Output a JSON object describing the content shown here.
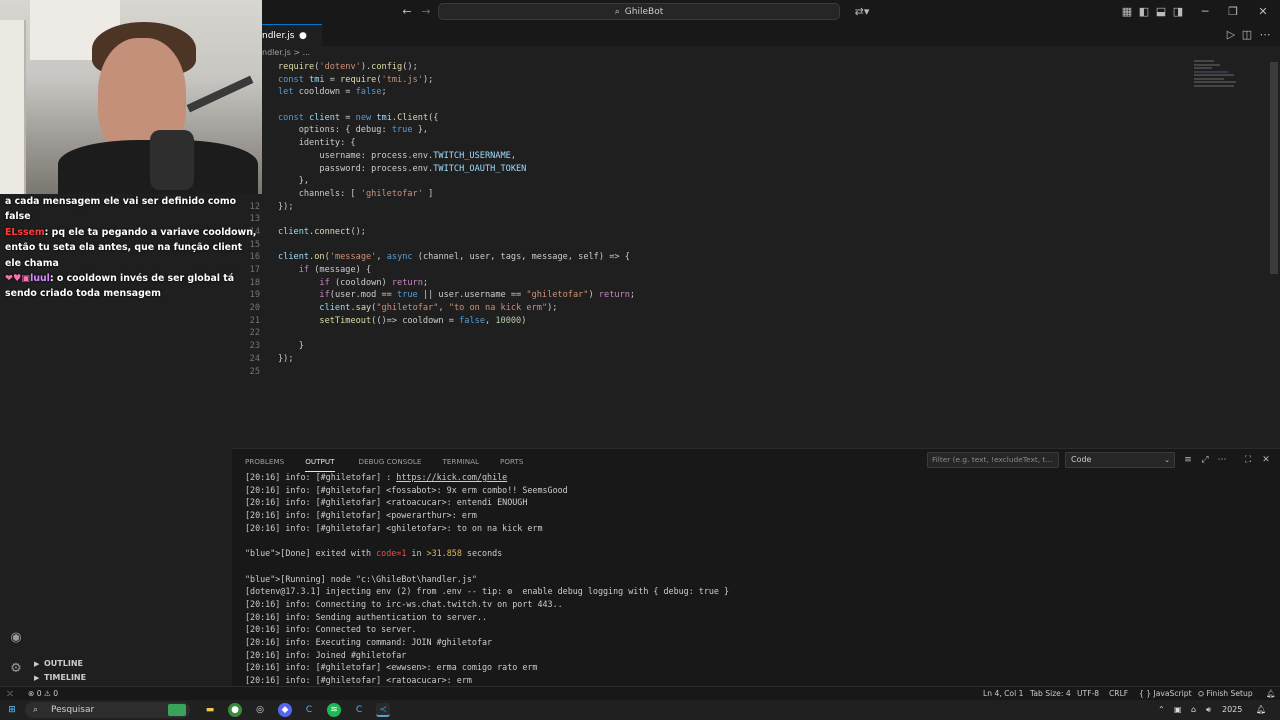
{
  "titlebar": {
    "search_text": "GhileBot"
  },
  "webcam_chat": {
    "messages": [
      {
        "user": "",
        "text": "a cada mensagem ele vai ser definido como false"
      },
      {
        "user": "ELssem",
        "text": ": pq ele ta pegando a variave cooldown, então tu seta ela antes, que na função client ele chama"
      },
      {
        "user": "luul",
        "text": ": o cooldown invés de ser global tá sendo criado toda mensagem"
      }
    ]
  },
  "sidebar": {
    "outline_label": "OUTLINE",
    "timeline_label": "TIMELINE"
  },
  "editor": {
    "tab_label": "ndler.js",
    "breadcrumb": "ndler.js > ...",
    "lines": [
      {
        "n": "",
        "t": "require('dotenv').config();"
      },
      {
        "n": "",
        "t": "const tmi = require('tmi.js');"
      },
      {
        "n": "",
        "t": "let cooldown = false;"
      },
      {
        "n": "",
        "t": ""
      },
      {
        "n": "",
        "t": "const client = new tmi.Client({"
      },
      {
        "n": "",
        "t": "    options: { debug: true },"
      },
      {
        "n": "",
        "t": "    identity: {"
      },
      {
        "n": "",
        "t": "        username: process.env.TWITCH_USERNAME,"
      },
      {
        "n": "",
        "t": "        password: process.env.TWITCH_OAUTH_TOKEN"
      },
      {
        "n": "",
        "t": "    },"
      },
      {
        "n": "",
        "t": "    channels: [ 'ghiletofar' ]"
      },
      {
        "n": "12",
        "t": "});"
      },
      {
        "n": "13",
        "t": ""
      },
      {
        "n": "14",
        "t": "client.connect();"
      },
      {
        "n": "15",
        "t": ""
      },
      {
        "n": "16",
        "t": "client.on('message', async (channel, user, tags, message, self) => {"
      },
      {
        "n": "17",
        "t": "    if (message) {"
      },
      {
        "n": "18",
        "t": "        if (cooldown) return;"
      },
      {
        "n": "19",
        "t": "        if(user.mod == true || user.username == \"ghiletofar\") return;"
      },
      {
        "n": "20",
        "t": "        client.say(\"ghiletofar\", \"to on na kick erm\");"
      },
      {
        "n": "21",
        "t": "        setTimeout(()=> cooldown = false, 10000)"
      },
      {
        "n": "22",
        "t": ""
      },
      {
        "n": "23",
        "t": "    }"
      },
      {
        "n": "24",
        "t": "});"
      },
      {
        "n": "25",
        "t": ""
      }
    ]
  },
  "panel": {
    "tabs": [
      "PROBLEMS",
      "OUTPUT",
      "DEBUG CONSOLE",
      "TERMINAL",
      "PORTS"
    ],
    "active_tab": "OUTPUT",
    "filter_placeholder": "Filter (e.g. text, !excludeText, t...",
    "channel_select": "Code",
    "output_lines": [
      "[20:16] info: [#ghiletofar] <fossabot>: https://kick.com/ghile",
      "[20:16] info: [#ghiletofar] <fossabot>: 9x erm combo!! SeemsGood",
      "[20:16] info: [#ghiletofar] <ratoacucar>: entendi ENOUGH",
      "[20:16] info: [#ghiletofar] <powerarthur>: erm",
      "[20:16] info: [#ghiletofar] <ghiletofar>: to on na kick erm",
      "",
      "[Done] exited with code=1 in 31.858 seconds",
      "",
      "[Running] node \"c:\\GhileBot\\handler.js\"",
      "[dotenv@17.3.1] injecting env (2) from .env -- tip: ⚙  enable debug logging with { debug: true }",
      "[20:16] info: Connecting to irc-ws.chat.twitch.tv on port 443..",
      "[20:16] info: Sending authentication to server..",
      "[20:16] info: Connected to server.",
      "[20:16] info: Executing command: JOIN #ghiletofar",
      "[20:16] info: Joined #ghiletofar",
      "[20:16] info: [#ghiletofar] <ewwsen>: erma comigo rato erm",
      "[20:16] info: [#ghiletofar] <ratoacucar>: erm"
    ]
  },
  "statusbar": {
    "problems": "⊗ 0 ⚠ 0",
    "position": "Ln 4, Col 1",
    "tab_size": "Tab Size: 4",
    "encoding": "UTF-8",
    "eol": "CRLF",
    "language": "{ } JavaScript",
    "finish_setup": "Finish Setup"
  },
  "taskbar": {
    "search_label": "Pesquisar",
    "clock": "2025"
  }
}
